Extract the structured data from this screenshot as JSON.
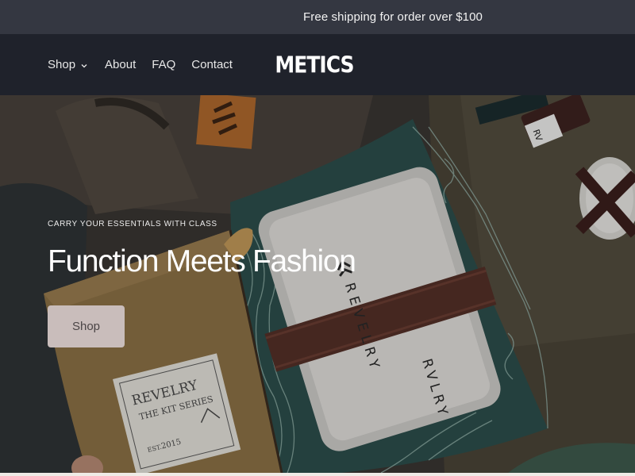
{
  "announcement": {
    "text": "Free shipping for order over $100"
  },
  "header": {
    "nav": [
      {
        "label": "Shop",
        "has_dropdown": true,
        "icon": "chevron-down-icon"
      },
      {
        "label": "About"
      },
      {
        "label": "FAQ"
      },
      {
        "label": "Contact"
      }
    ],
    "logo": "METICS"
  },
  "hero": {
    "eyebrow": "CARRY YOUR ESSENTIALS WITH CLASS",
    "headline": "Function Meets Fashion",
    "cta_label": "Shop",
    "image": {
      "label_top": "REVELRY",
      "label_mid": "THE KIT SERIES",
      "label_est": "EST.",
      "label_year": "2015",
      "tray_brand": "REVELRY",
      "tray_brand_2": "RVLRY",
      "tag_text": "RV"
    }
  },
  "colors": {
    "announcement_bg": "#343741",
    "header_bg": "#1f222b",
    "cta_bg": "#c9bdbb",
    "cta_text": "#4b4546"
  }
}
